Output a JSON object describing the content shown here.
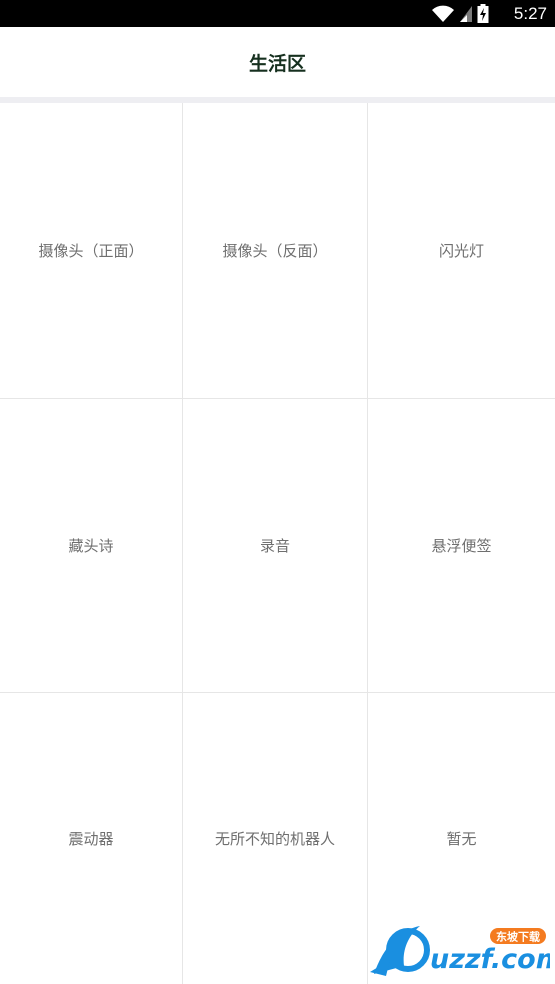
{
  "status_bar": {
    "time": "5:27",
    "icons": [
      "wifi-icon",
      "signal-icon",
      "battery-charging-icon"
    ]
  },
  "header": {
    "title": "生活区"
  },
  "tiles": [
    {
      "label": "摄像头（正面）"
    },
    {
      "label": "摄像头（反面）"
    },
    {
      "label": "闪光灯"
    },
    {
      "label": "藏头诗"
    },
    {
      "label": "录音"
    },
    {
      "label": "悬浮便签"
    },
    {
      "label": "震动器"
    },
    {
      "label": "无所不知的机器人"
    },
    {
      "label": "暂无"
    }
  ],
  "watermark": {
    "brand": "uzzf.com",
    "tag": "东坡下载"
  },
  "colors": {
    "status_bg": "#000000",
    "title_text": "#16301f",
    "tile_text": "#6f6f6f",
    "divider": "#eeeef2",
    "grid_line": "#e6e6e6",
    "watermark_blue": "#1a8fe0",
    "watermark_orange": "#f47b20"
  }
}
